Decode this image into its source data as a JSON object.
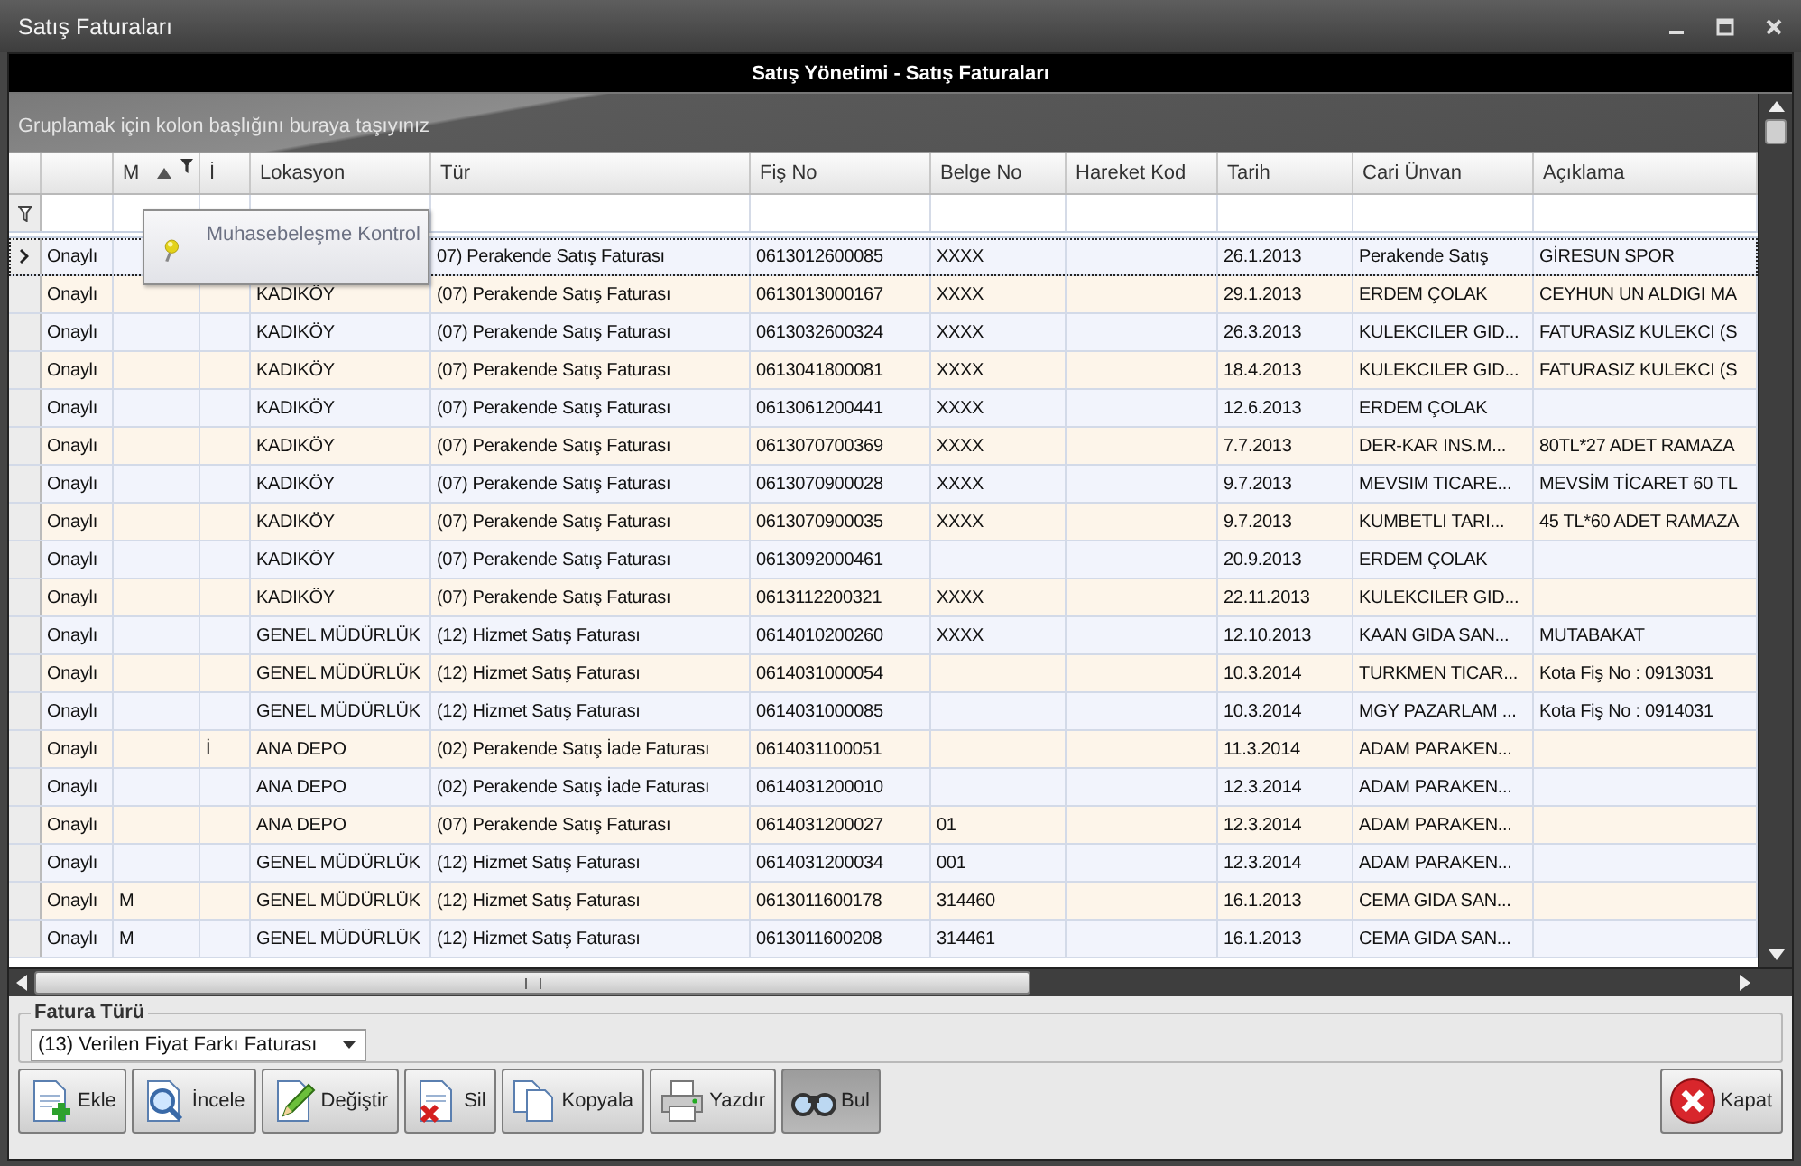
{
  "window": {
    "title": "Satış Faturaları"
  },
  "header": {
    "title": "Satış Yönetimi - Satış Faturaları"
  },
  "group_panel": {
    "hint": "Gruplamak için kolon başlığını buraya taşıyınız"
  },
  "columns": [
    {
      "label": "M",
      "sorted": true,
      "filtered": true
    },
    {
      "label": "İ",
      "sorted": false,
      "filtered": false
    },
    {
      "label": "Lokasyon",
      "sorted": false,
      "filtered": false
    },
    {
      "label": "Tür",
      "sorted": false,
      "filtered": false
    },
    {
      "label": "Fiş No",
      "sorted": false,
      "filtered": false
    },
    {
      "label": "Belge No",
      "sorted": false,
      "filtered": false
    },
    {
      "label": "Hareket Kod",
      "sorted": false,
      "filtered": false
    },
    {
      "label": "Tarih",
      "sorted": false,
      "filtered": false
    },
    {
      "label": "Cari Ünvan",
      "sorted": false,
      "filtered": false
    },
    {
      "label": "Açıklama",
      "sorted": false,
      "filtered": false
    }
  ],
  "rows": [
    {
      "selected": true,
      "status": "Onaylı",
      "tur": "07) Perakende Satış Faturası",
      "fis_no": "0613012600085",
      "belge_no": "XXXX",
      "tarih": "26.1.2013",
      "cari_unvan": "Perakende Satış",
      "aciklama": "GİRESUN SPOR"
    },
    {
      "selected": false,
      "status": "Onaylı",
      "lokasyon": "KADIKÖY",
      "tur": "(07) Perakende Satış Faturası",
      "fis_no": "0613013000167",
      "belge_no": "XXXX",
      "tarih": "29.1.2013",
      "cari_unvan": "ERDEM ÇOLAK",
      "aciklama": "CEYHUN UN ALDIGI MA"
    },
    {
      "selected": false,
      "status": "Onaylı",
      "lokasyon": "KADIKÖY",
      "tur": "(07) Perakende Satış Faturası",
      "fis_no": "0613032600324",
      "belge_no": "XXXX",
      "tarih": "26.3.2013",
      "cari_unvan": "KULEKCILER GID...",
      "aciklama": "FATURASIZ KULEKCI (S"
    },
    {
      "selected": false,
      "status": "Onaylı",
      "lokasyon": "KADIKÖY",
      "tur": "(07) Perakende Satış Faturası",
      "fis_no": "0613041800081",
      "belge_no": "XXXX",
      "tarih": "18.4.2013",
      "cari_unvan": "KULEKCILER GID...",
      "aciklama": "FATURASIZ KULEKCI (S"
    },
    {
      "selected": false,
      "status": "Onaylı",
      "lokasyon": "KADIKÖY",
      "tur": "(07) Perakende Satış Faturası",
      "fis_no": "0613061200441",
      "belge_no": "XXXX",
      "tarih": "12.6.2013",
      "cari_unvan": "ERDEM ÇOLAK"
    },
    {
      "selected": false,
      "status": "Onaylı",
      "lokasyon": "KADIKÖY",
      "tur": "(07) Perakende Satış Faturası",
      "fis_no": "0613070700369",
      "belge_no": "XXXX",
      "tarih": "7.7.2013",
      "cari_unvan": "DER-KAR INS.M...",
      "aciklama": "80TL*27 ADET RAMAZA"
    },
    {
      "selected": false,
      "status": "Onaylı",
      "lokasyon": "KADIKÖY",
      "tur": "(07) Perakende Satış Faturası",
      "fis_no": "0613070900028",
      "belge_no": "XXXX",
      "tarih": "9.7.2013",
      "cari_unvan": "MEVSIM TICARE...",
      "aciklama": "MEVSİM TİCARET 60 TL"
    },
    {
      "selected": false,
      "status": "Onaylı",
      "lokasyon": "KADIKÖY",
      "tur": "(07) Perakende Satış Faturası",
      "fis_no": "0613070900035",
      "belge_no": "XXXX",
      "tarih": "9.7.2013",
      "cari_unvan": "KUMBETLI TARI...",
      "aciklama": "45 TL*60 ADET RAMAZA"
    },
    {
      "selected": false,
      "status": "Onaylı",
      "lokasyon": "KADIKÖY",
      "tur": "(07) Perakende Satış Faturası",
      "fis_no": "0613092000461",
      "tarih": "20.9.2013",
      "cari_unvan": "ERDEM ÇOLAK"
    },
    {
      "selected": false,
      "status": "Onaylı",
      "lokasyon": "KADIKÖY",
      "tur": "(07) Perakende Satış Faturası",
      "fis_no": "0613112200321",
      "belge_no": "XXXX",
      "tarih": "22.11.2013",
      "cari_unvan": "KULEKCILER GID..."
    },
    {
      "selected": false,
      "status": "Onaylı",
      "lokasyon": "GENEL MÜDÜRLÜK",
      "tur": "(12) Hizmet Satış Faturası",
      "fis_no": "0614010200260",
      "belge_no": "XXXX",
      "tarih": "12.10.2013",
      "cari_unvan": "KAAN GIDA SAN...",
      "aciklama": "MUTABAKAT"
    },
    {
      "selected": false,
      "status": "Onaylı",
      "lokasyon": "GENEL MÜDÜRLÜK",
      "tur": "(12) Hizmet Satış Faturası",
      "fis_no": "0614031000054",
      "tarih": "10.3.2014",
      "cari_unvan": "TURKMEN TICAR...",
      "aciklama": "Kota Fiş No : 0913031"
    },
    {
      "selected": false,
      "status": "Onaylı",
      "lokasyon": "GENEL MÜDÜRLÜK",
      "tur": "(12) Hizmet Satış Faturası",
      "fis_no": "0614031000085",
      "tarih": "10.3.2014",
      "cari_unvan": "MGY PAZARLAM ...",
      "aciklama": "Kota Fiş No : 0914031"
    },
    {
      "selected": false,
      "status": "Onaylı",
      "i": "İ",
      "lokasyon": "ANA DEPO",
      "tur": "(02) Perakende Satış İade Faturası",
      "fis_no": "0614031100051",
      "tarih": "11.3.2014",
      "cari_unvan": "ADAM PARAKEN..."
    },
    {
      "selected": false,
      "status": "Onaylı",
      "lokasyon": "ANA DEPO",
      "tur": "(02) Perakende Satış İade Faturası",
      "fis_no": "0614031200010",
      "tarih": "12.3.2014",
      "cari_unvan": "ADAM PARAKEN..."
    },
    {
      "selected": false,
      "status": "Onaylı",
      "lokasyon": "ANA DEPO",
      "tur": "(07) Perakende Satış Faturası",
      "fis_no": "0614031200027",
      "belge_no": "01",
      "tarih": "12.3.2014",
      "cari_unvan": "ADAM PARAKEN..."
    },
    {
      "selected": false,
      "status": "Onaylı",
      "lokasyon": "GENEL MÜDÜRLÜK",
      "tur": "(12) Hizmet Satış Faturası",
      "fis_no": "0614031200034",
      "belge_no": "001",
      "tarih": "12.3.2014",
      "cari_unvan": "ADAM PARAKEN..."
    },
    {
      "selected": false,
      "status": "Onaylı",
      "m": "M",
      "lokasyon": "GENEL MÜDÜRLÜK",
      "tur": "(12) Hizmet Satış Faturası",
      "fis_no": "0613011600178",
      "belge_no": "314460",
      "tarih": "16.1.2013",
      "cari_unvan": "CEMA GIDA SAN..."
    },
    {
      "selected": false,
      "status": "Onaylı",
      "m": "M",
      "lokasyon": "GENEL MÜDÜRLÜK",
      "tur": "(12) Hizmet Satış Faturası",
      "fis_no": "0613011600208",
      "belge_no": "314461",
      "tarih": "16.1.2013",
      "cari_unvan": "CEMA GIDA SAN..."
    }
  ],
  "tooltip": {
    "text": "Muhasebeleşme Kontrol"
  },
  "filter_group": {
    "title": "Fatura Türü",
    "combo_value": "(13) Verilen Fiyat Farkı Faturası"
  },
  "buttons": [
    {
      "label": "Ekle",
      "kind": "add",
      "pressed": false
    },
    {
      "label": "İncele",
      "kind": "view",
      "pressed": false
    },
    {
      "label": "Değiştir",
      "kind": "edit",
      "pressed": false
    },
    {
      "label": "Sil",
      "kind": "delete",
      "pressed": false
    },
    {
      "label": "Kopyala",
      "kind": "copy",
      "pressed": false
    },
    {
      "label": "Yazdır",
      "kind": "print",
      "pressed": false
    },
    {
      "label": "Bul",
      "kind": "find",
      "pressed": true
    }
  ],
  "close_button": {
    "label": "Kapat",
    "kind": "close"
  }
}
